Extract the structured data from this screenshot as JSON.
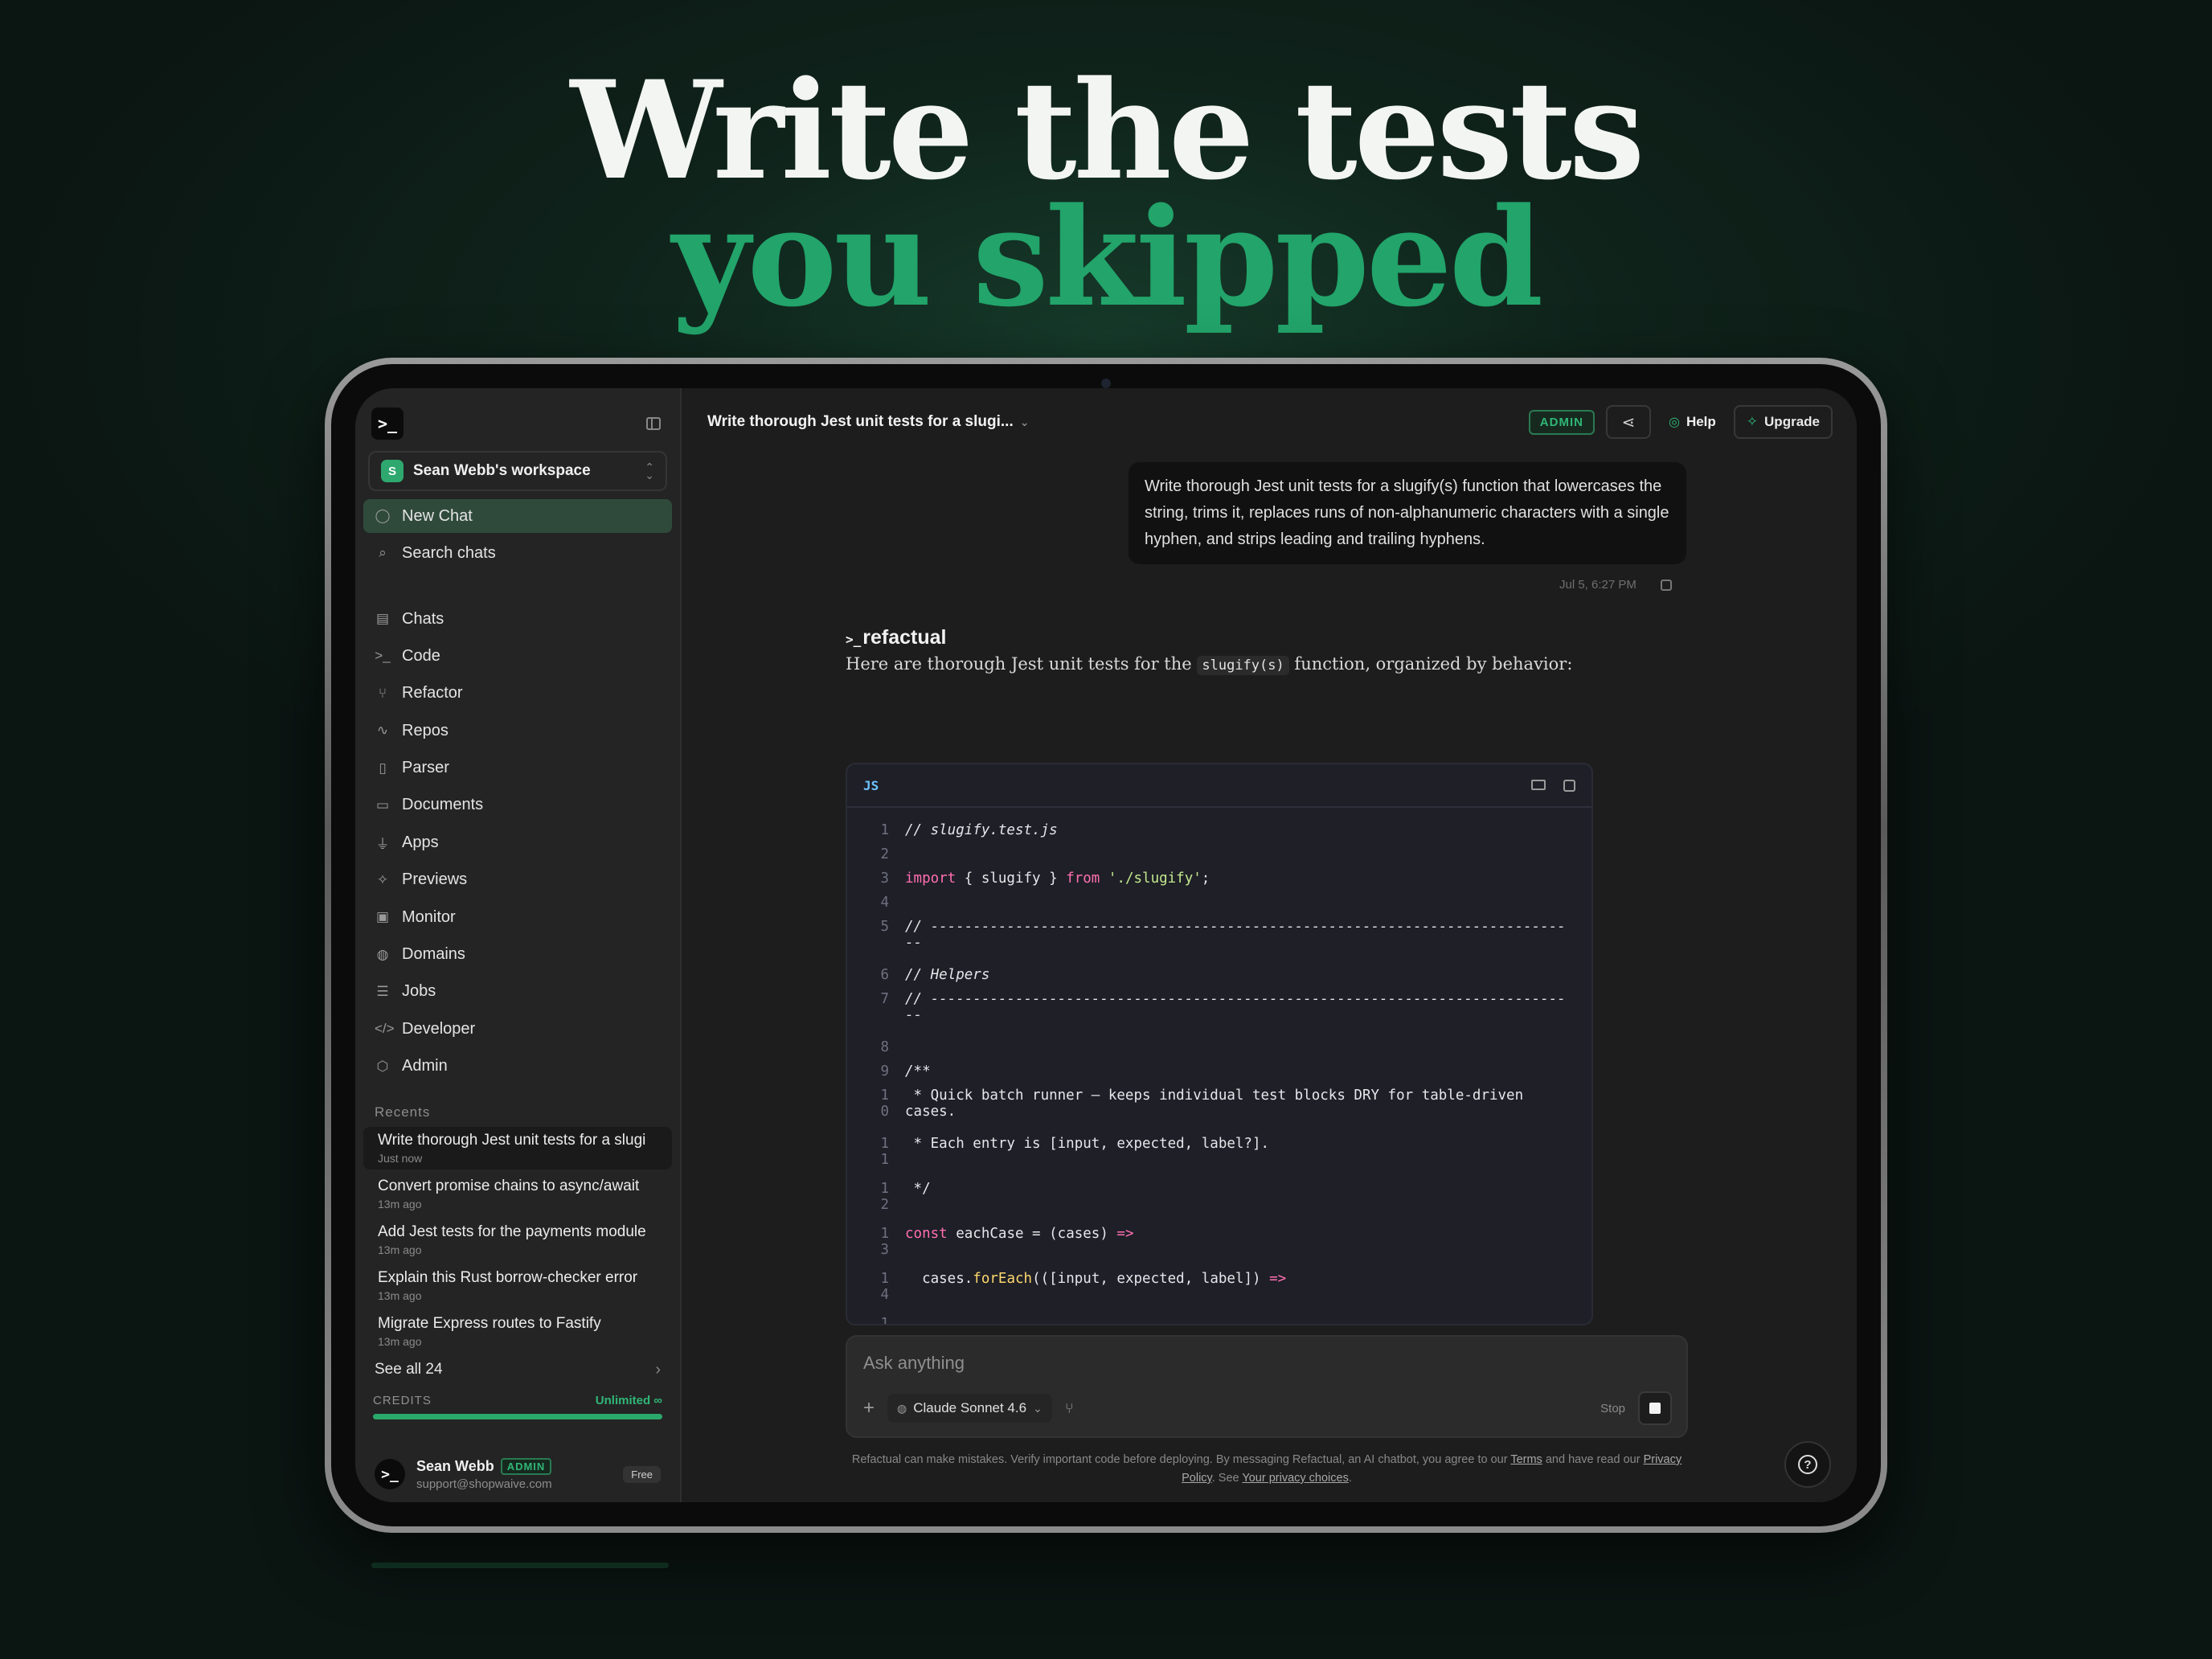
{
  "hero": {
    "line1": "Write the tests",
    "line2": "you skipped"
  },
  "app": {
    "logo_glyph": ">_"
  },
  "sidebar": {
    "workspace": {
      "initial": "S",
      "name": "Sean Webb's workspace"
    },
    "primary": [
      {
        "label": "New Chat",
        "icon": "chat-bubble-icon",
        "glyph": "◯"
      },
      {
        "label": "Search chats",
        "icon": "search-icon",
        "glyph": "⌕"
      }
    ],
    "items": [
      {
        "label": "Chats",
        "icon": "chats-icon",
        "glyph": "▤"
      },
      {
        "label": "Code",
        "icon": "terminal-icon",
        "glyph": ">_"
      },
      {
        "label": "Refactor",
        "icon": "branch-icon",
        "glyph": "⑂"
      },
      {
        "label": "Repos",
        "icon": "activity-icon",
        "glyph": "∿"
      },
      {
        "label": "Parser",
        "icon": "file-icon",
        "glyph": "▯"
      },
      {
        "label": "Documents",
        "icon": "folder-icon",
        "glyph": "▭"
      },
      {
        "label": "Apps",
        "icon": "plug-icon",
        "glyph": "⏚"
      },
      {
        "label": "Previews",
        "icon": "sparkle-icon",
        "glyph": "✧"
      },
      {
        "label": "Monitor",
        "icon": "monitor-icon",
        "glyph": "▣"
      },
      {
        "label": "Domains",
        "icon": "globe-icon",
        "glyph": "◍"
      },
      {
        "label": "Jobs",
        "icon": "list-check-icon",
        "glyph": "☰"
      },
      {
        "label": "Developer",
        "icon": "code-icon",
        "glyph": "</>"
      },
      {
        "label": "Admin",
        "icon": "shield-icon",
        "glyph": "⬡"
      }
    ],
    "recents_label": "Recents",
    "recents": [
      {
        "title": "Write thorough Jest unit tests for a slugi",
        "age": "Just now"
      },
      {
        "title": "Convert promise chains to async/await",
        "age": "13m ago"
      },
      {
        "title": "Add Jest tests for the payments module",
        "age": "13m ago"
      },
      {
        "title": "Explain this Rust borrow-checker error",
        "age": "13m ago"
      },
      {
        "title": "Migrate Express routes to Fastify",
        "age": "13m ago"
      }
    ],
    "see_all": "See all 24",
    "credits": {
      "label": "CREDITS",
      "value": "Unlimited ∞",
      "fraction": 1.0
    },
    "user": {
      "name": "Sean Webb",
      "role": "ADMIN",
      "email": "support@shopwaive.com",
      "plan": "Free"
    }
  },
  "topbar": {
    "title": "Write thorough Jest unit tests for a slugi...",
    "admin_badge": "ADMIN",
    "help": "Help",
    "upgrade": "Upgrade"
  },
  "conversation": {
    "user_message": "Write thorough Jest unit tests for a slugify(s) function that lowercases the string, trims it, replaces runs of non-alphanumeric characters with a single hyphen, and strips leading and trailing hyphens.",
    "timestamp": "Jul 5, 6:27 PM",
    "assistant_name": "refactual",
    "assistant_prompt_glyph": ">_",
    "assistant_text_before": "Here are thorough Jest unit tests for the",
    "assistant_code": "slugify(s)",
    "assistant_text_after": "function, organized by behavior:",
    "code_lang": "JS"
  },
  "composer": {
    "placeholder": "Ask anything",
    "model": "Claude Sonnet 4.6",
    "stop": "Stop"
  },
  "disclaimer": {
    "part1": "Refactual can make mistakes. Verify important code before deploying. By messaging Refactual, an AI chatbot, you agree to our",
    "terms": "Terms",
    "part2": "and have read our",
    "privacy": "Privacy Policy",
    "part3": ". See",
    "choices": "Your privacy choices",
    "part4": "."
  },
  "colors": {
    "accent": "#22a46a",
    "bg": "#0f231b",
    "code_bg": "#1e1f27"
  }
}
